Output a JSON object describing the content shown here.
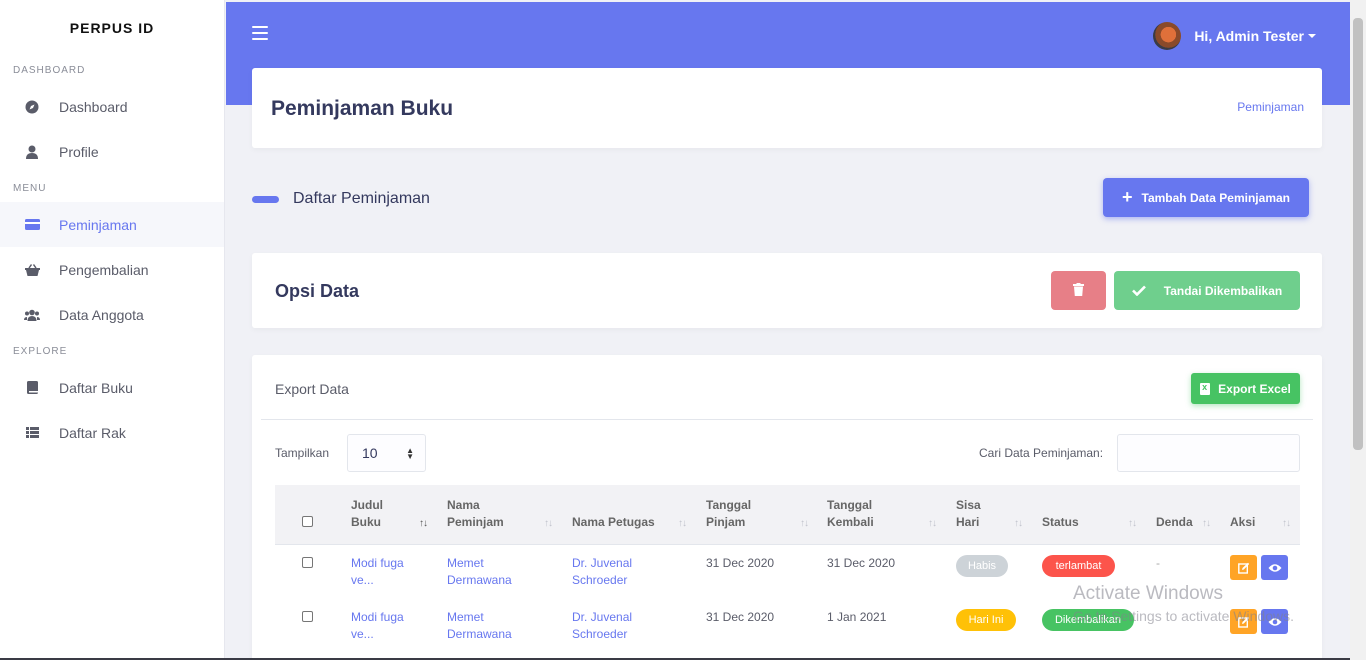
{
  "brand": "PERPUS ID",
  "sidebar": {
    "sections": [
      {
        "heading": "DASHBOARD",
        "items": [
          {
            "label": "Dashboard",
            "icon": "compass-icon"
          },
          {
            "label": "Profile",
            "icon": "user-icon"
          }
        ]
      },
      {
        "heading": "MENU",
        "items": [
          {
            "label": "Peminjaman",
            "icon": "card-icon",
            "active": true
          },
          {
            "label": "Pengembalian",
            "icon": "basket-icon"
          },
          {
            "label": "Data Anggota",
            "icon": "users-icon"
          }
        ]
      },
      {
        "heading": "EXPLORE",
        "items": [
          {
            "label": "Daftar Buku",
            "icon": "book-icon"
          },
          {
            "label": "Daftar Rak",
            "icon": "list-icon"
          }
        ]
      }
    ]
  },
  "topbar": {
    "user_greeting": "Hi, Admin Tester"
  },
  "page": {
    "title": "Peminjaman Buku",
    "breadcrumb": "Peminjaman"
  },
  "section": {
    "title": "Daftar Peminjaman",
    "add_button": "Tambah Data Peminjaman"
  },
  "opsi": {
    "title": "Opsi Data",
    "return_button": "Tandai Dikembalikan"
  },
  "table_card": {
    "export_label": "Export Data",
    "excel_button": "Export Excel",
    "show_label": "Tampilkan",
    "show_value": "10",
    "search_label": "Cari Data Peminjaman:",
    "search_value": ""
  },
  "table": {
    "headers": {
      "judul": [
        "Judul",
        "Buku"
      ],
      "nama": [
        "Nama",
        "Peminjam"
      ],
      "petugas": "Nama Petugas",
      "pinjam": [
        "Tanggal",
        "Pinjam"
      ],
      "kembali": [
        "Tanggal",
        "Kembali"
      ],
      "sisa": [
        "Sisa",
        "Hari"
      ],
      "status": "Status",
      "denda": "Denda",
      "aksi": "Aksi"
    },
    "rows": [
      {
        "judul": [
          "Modi fuga",
          "ve..."
        ],
        "nama": [
          "Memet",
          "Dermawana"
        ],
        "petugas": [
          "Dr. Juvenal",
          "Schroeder"
        ],
        "pinjam": "31 Dec 2020",
        "kembali": "31 Dec 2020",
        "sisa": "Habis",
        "status": "terlambat",
        "denda": "-"
      },
      {
        "judul": [
          "Modi fuga",
          "ve..."
        ],
        "nama": [
          "Memet",
          "Dermawana"
        ],
        "petugas": [
          "Dr. Juvenal",
          "Schroeder"
        ],
        "pinjam": "31 Dec 2020",
        "kembali": "1 Jan 2021",
        "sisa": "Hari Ini",
        "status": "Dikembalikan",
        "denda": ""
      }
    ]
  },
  "watermark": {
    "line1": "Activate Windows",
    "line2": "Go to Settings to activate Windows."
  },
  "colors": {
    "primary": "#6777ef",
    "success": "#47c363",
    "danger": "#fc544b",
    "warning": "#ffa426",
    "yellow": "#ffc107"
  }
}
